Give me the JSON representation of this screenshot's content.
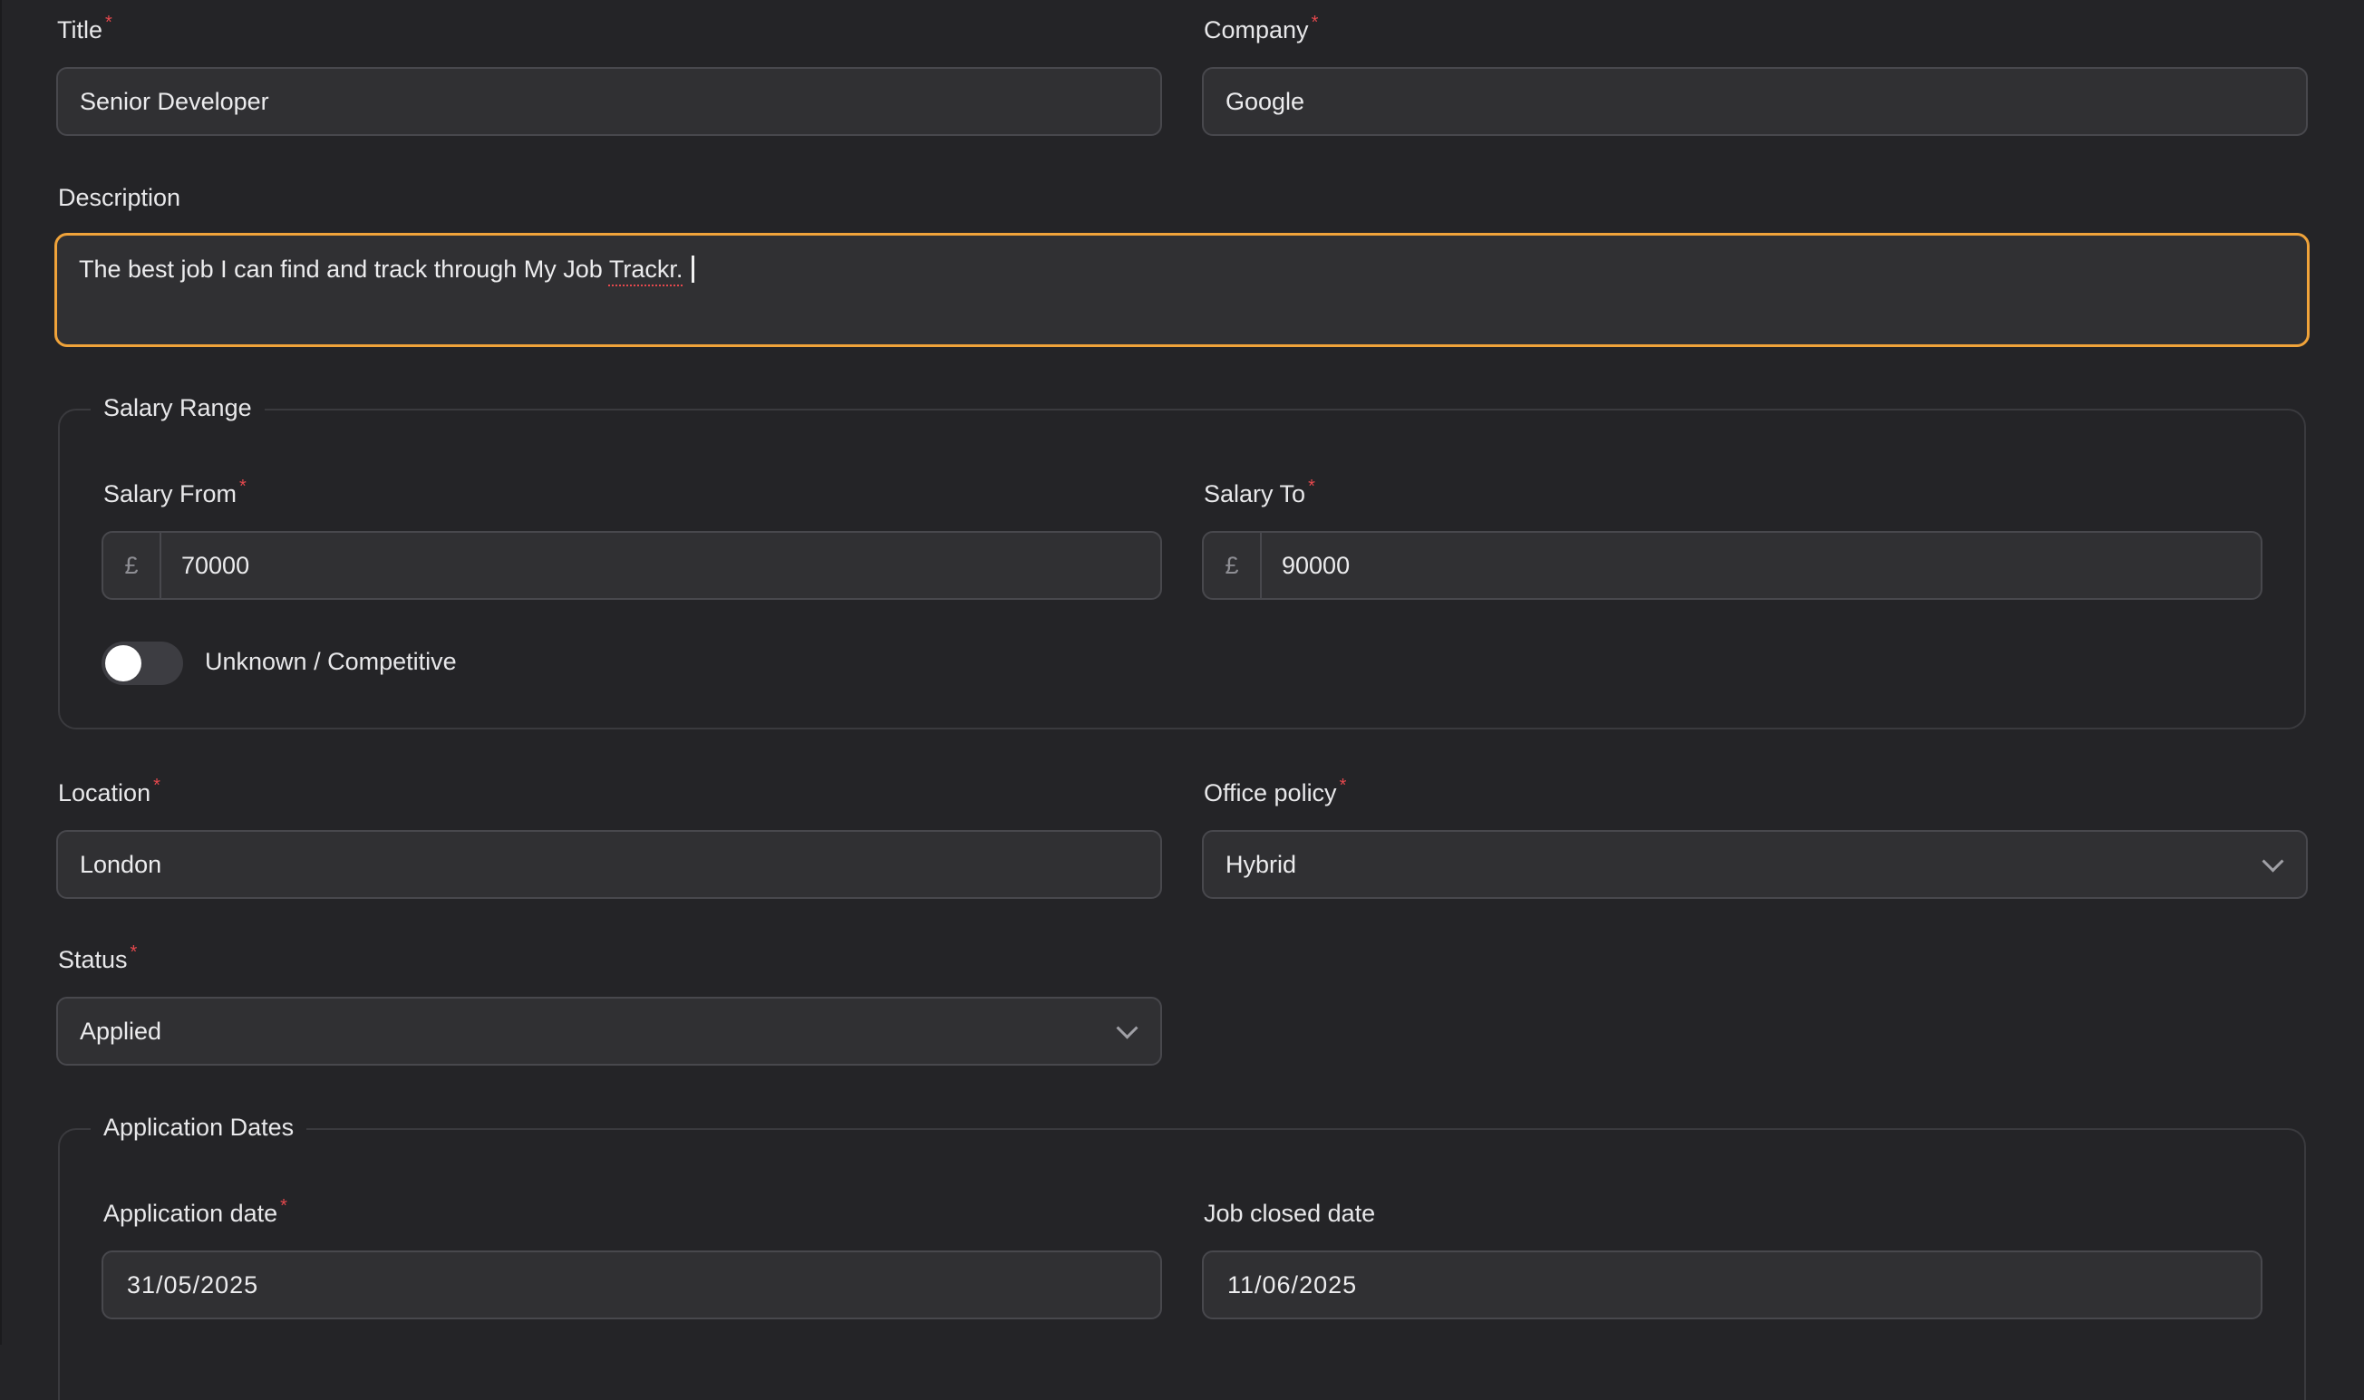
{
  "form": {
    "title": {
      "label": "Title",
      "value": "Senior Developer"
    },
    "company": {
      "label": "Company",
      "value": "Google"
    },
    "description": {
      "label": "Description",
      "value_main": "The best job I can find and track through My Job ",
      "value_flagged": "Trackr.",
      "value_end": ""
    },
    "salary_range": {
      "legend": "Salary Range",
      "from": {
        "label": "Salary From",
        "currency": "£",
        "value": "70000"
      },
      "to": {
        "label": "Salary To",
        "currency": "£",
        "value": "90000"
      },
      "unknown_toggle": {
        "label": "Unknown / Competitive",
        "checked": false
      }
    },
    "location": {
      "label": "Location",
      "value": "London"
    },
    "office_policy": {
      "label": "Office policy",
      "value": "Hybrid"
    },
    "status": {
      "label": "Status",
      "value": "Applied"
    },
    "application_dates": {
      "legend": "Application Dates",
      "application_date": {
        "label": "Application date",
        "value": "31/05/2025"
      },
      "job_closed_date": {
        "label": "Job closed date",
        "value": "11/06/2025"
      }
    },
    "required_marker": "*"
  },
  "colors": {
    "background": "#242427",
    "field_bg": "#303033",
    "focus_border": "#f0a33a",
    "required": "#e5484d"
  }
}
